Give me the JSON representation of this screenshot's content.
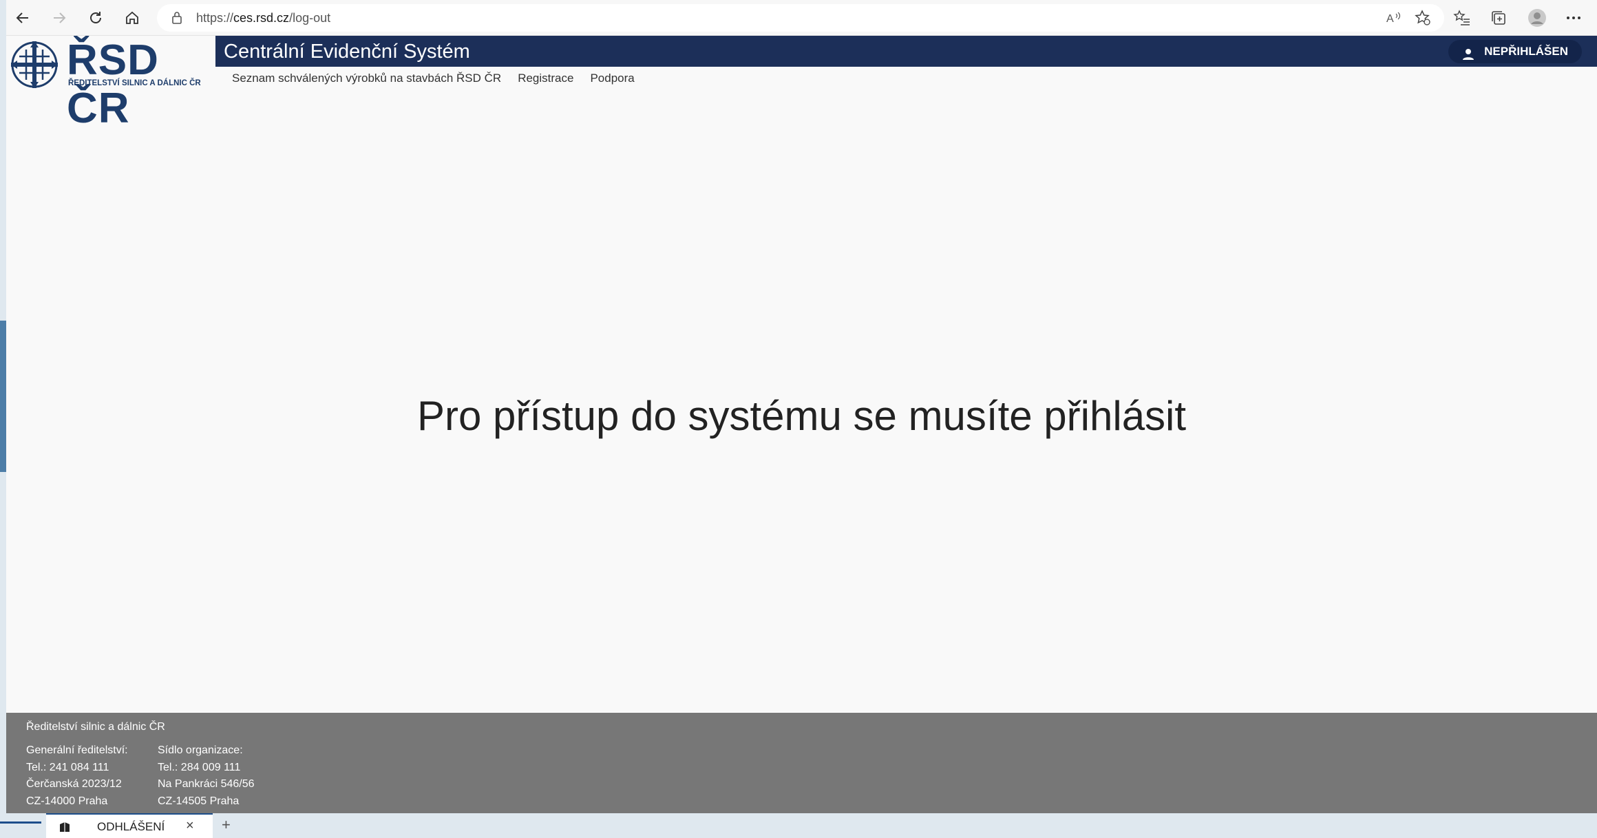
{
  "browser": {
    "url_prefix": "https://",
    "url_host": "ces.rsd.cz",
    "url_path": "/log-out"
  },
  "logo": {
    "name": "ŘSD ČR",
    "subtitle": "ŘEDITELSTVÍ SILNIC A DÁLNIC ČR"
  },
  "header": {
    "title": "Centrální Evidenční Systém",
    "login_label": "NEPŘIHLÁŠEN"
  },
  "menu": {
    "items": [
      "Seznam schválených výrobků na stavbách ŘSD ČR",
      "Registrace",
      "Podpora"
    ]
  },
  "main": {
    "message": "Pro přístup do systému se musíte přihlásit"
  },
  "footer": {
    "org": "Ředitelství silnic a dálnic ČR",
    "col1": [
      "Generální ředitelství:",
      "Tel.: 241 084 111",
      "Čerčanská 2023/12",
      "CZ-14000 Praha"
    ],
    "col2": [
      "Sídlo organizace:",
      "Tel.: 284 009 111",
      "Na Pankráci 546/56",
      "CZ-14505 Praha"
    ]
  },
  "tabs": {
    "active_label": "ODHLÁŠENÍ",
    "close": "×",
    "new_tab": "+"
  },
  "colors": {
    "header_navy": "#1c2f59",
    "logo_blue": "#1e3d6b",
    "footer_gray": "#777777"
  }
}
